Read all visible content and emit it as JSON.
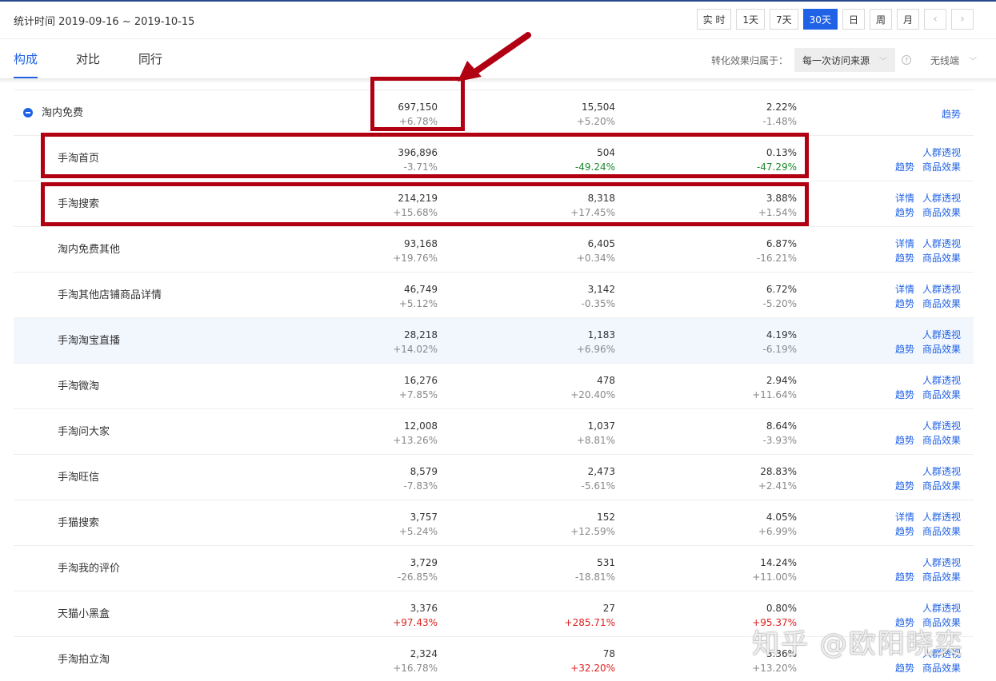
{
  "header": {
    "stat_time": "统计时间 2019-09-16 ~ 2019-10-15",
    "period_buttons": [
      "实 时",
      "1天",
      "7天",
      "30天",
      "日",
      "周",
      "月"
    ],
    "active_period": "30天",
    "prev_arrow": "‹",
    "next_arrow": "›"
  },
  "tabs": [
    "构成",
    "对比",
    "同行"
  ],
  "active_tab": "构成",
  "attribution": {
    "label": "转化效果归属于：",
    "value": "每一次访问来源",
    "help": "?",
    "device": "无线端"
  },
  "rows": [
    {
      "name": "淘内免费",
      "parent": true,
      "m1": "697,150",
      "c1": "+6.78%",
      "m2": "15,504",
      "c2": "+5.20%",
      "m3": "2.22%",
      "c3": "-1.48%",
      "actions": {
        "trend_only": "趋势"
      }
    },
    {
      "name": "手淘首页",
      "m1": "396,896",
      "c1": "-3.71%",
      "m2": "504",
      "c2": "-49.24%",
      "c2color": "green",
      "m3": "0.13%",
      "c3": "-47.29%",
      "c3color": "green",
      "actions": {
        "people": "人群透视",
        "trend": "趋势",
        "goods": "商品效果"
      }
    },
    {
      "name": "手淘搜索",
      "m1": "214,219",
      "c1": "+15.68%",
      "m2": "8,318",
      "c2": "+17.45%",
      "m3": "3.88%",
      "c3": "+1.54%",
      "actions": {
        "detail": "详情",
        "people": "人群透视",
        "trend": "趋势",
        "goods": "商品效果"
      }
    },
    {
      "name": "淘内免费其他",
      "m1": "93,168",
      "c1": "+19.76%",
      "m2": "6,405",
      "c2": "+0.34%",
      "m3": "6.87%",
      "c3": "-16.21%",
      "actions": {
        "detail": "详情",
        "people": "人群透视",
        "trend": "趋势",
        "goods": "商品效果"
      }
    },
    {
      "name": "手淘其他店铺商品详情",
      "m1": "46,749",
      "c1": "+5.12%",
      "m2": "3,142",
      "c2": "-0.35%",
      "m3": "6.72%",
      "c3": "-5.20%",
      "actions": {
        "detail": "详情",
        "people": "人群透视",
        "trend": "趋势",
        "goods": "商品效果"
      }
    },
    {
      "name": "手淘淘宝直播",
      "highlight": true,
      "m1": "28,218",
      "c1": "+14.02%",
      "m2": "1,183",
      "c2": "+6.96%",
      "m3": "4.19%",
      "c3": "-6.19%",
      "actions": {
        "people": "人群透视",
        "trend": "趋势",
        "goods": "商品效果"
      }
    },
    {
      "name": "手淘微淘",
      "m1": "16,276",
      "c1": "+7.85%",
      "m2": "478",
      "c2": "+20.40%",
      "m3": "2.94%",
      "c3": "+11.64%",
      "actions": {
        "people": "人群透视",
        "trend": "趋势",
        "goods": "商品效果"
      }
    },
    {
      "name": "手淘问大家",
      "m1": "12,008",
      "c1": "+13.26%",
      "m2": "1,037",
      "c2": "+8.81%",
      "m3": "8.64%",
      "c3": "-3.93%",
      "actions": {
        "people": "人群透视",
        "trend": "趋势",
        "goods": "商品效果"
      }
    },
    {
      "name": "手淘旺信",
      "m1": "8,579",
      "c1": "-7.83%",
      "m2": "2,473",
      "c2": "-5.61%",
      "m3": "28.83%",
      "c3": "+2.41%",
      "actions": {
        "people": "人群透视",
        "trend": "趋势",
        "goods": "商品效果"
      }
    },
    {
      "name": "手猫搜索",
      "m1": "3,757",
      "c1": "+5.24%",
      "m2": "152",
      "c2": "+12.59%",
      "m3": "4.05%",
      "c3": "+6.99%",
      "actions": {
        "detail": "详情",
        "people": "人群透视",
        "trend": "趋势",
        "goods": "商品效果"
      }
    },
    {
      "name": "手淘我的评价",
      "m1": "3,729",
      "c1": "-26.85%",
      "m2": "531",
      "c2": "-18.81%",
      "m3": "14.24%",
      "c3": "+11.00%",
      "actions": {
        "people": "人群透视",
        "trend": "趋势",
        "goods": "商品效果"
      }
    },
    {
      "name": "天猫小黑盒",
      "m1": "3,376",
      "c1": "+97.43%",
      "c1color": "red",
      "m2": "27",
      "c2": "+285.71%",
      "c2color": "red",
      "m3": "0.80%",
      "c3": "+95.37%",
      "c3color": "red",
      "actions": {
        "people": "人群透视",
        "trend": "趋势",
        "goods": "商品效果"
      }
    },
    {
      "name": "手淘拍立淘",
      "m1": "2,324",
      "c1": "+16.78%",
      "m2": "78",
      "c2": "+32.20%",
      "c2color": "red",
      "m3": "3.36%",
      "c3": "+13.20%",
      "actions": {
        "people": "人群透视",
        "trend": "趋势",
        "goods": "商品效果"
      }
    }
  ],
  "watermark": "知乎 @欧阳晓奕",
  "colors": {
    "accent": "#2062e6",
    "annotation_red": "#b00012",
    "up_red": "#e02020",
    "down_green": "#1a8a2a"
  }
}
